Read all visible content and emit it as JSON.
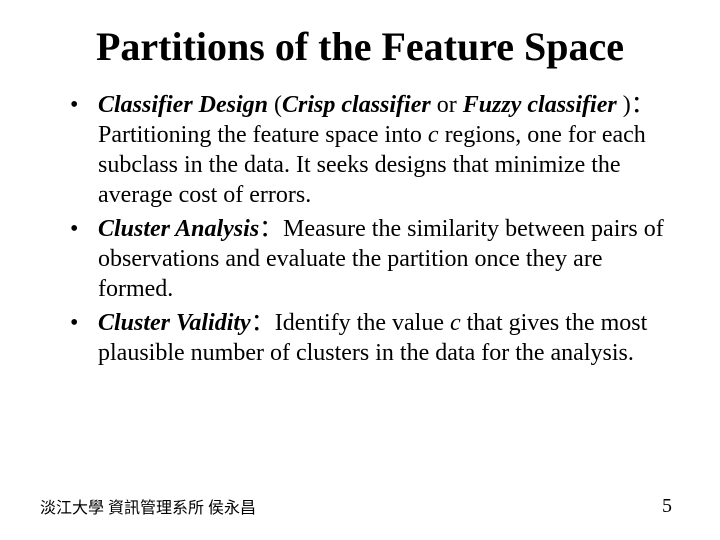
{
  "title": "Partitions of the Feature Space",
  "bullets": {
    "b1": {
      "term": "Classifier Design",
      "paren_open": " (",
      "crisp": "Crisp classifier",
      "or": " or ",
      "fuzzy": "Fuzzy classifier ",
      "paren_close": ")",
      "sep": "：",
      "body_a": "Partitioning the feature space into ",
      "c": "c",
      "body_b": " regions, one for each subclass in the data. It seeks designs that minimize the average cost of errors."
    },
    "b2": {
      "term": "Cluster Analysis",
      "sep": "：",
      "body": "Measure the similarity between pairs of observations and evaluate the partition once they are formed."
    },
    "b3": {
      "term": "Cluster Validity",
      "sep": "：",
      "body_a": "Identify the value ",
      "c": "c",
      "body_b": " that gives the most plausible number of clusters in the data for the analysis."
    }
  },
  "footer": "淡江大學  資訊管理系所  侯永昌",
  "page_number": "5"
}
